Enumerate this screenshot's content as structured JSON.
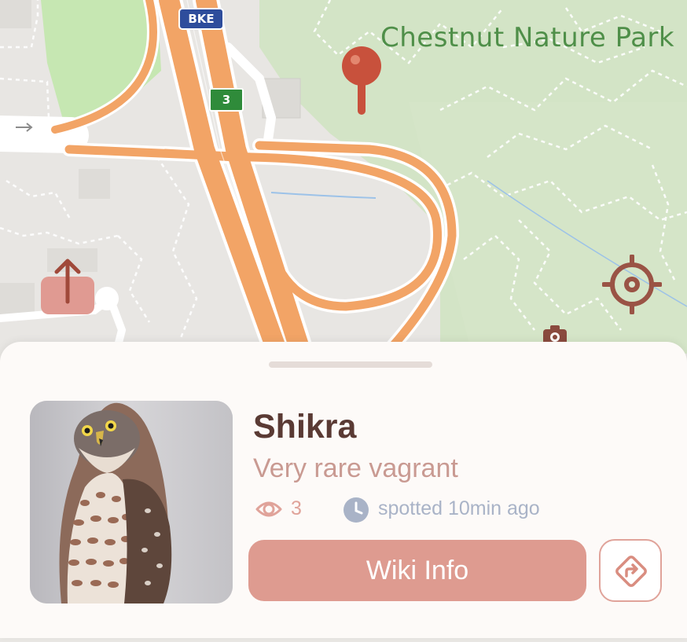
{
  "map": {
    "park_label": "Chestnut Nature Park",
    "road_shield_label": "BKE",
    "exit_shield_label": "3",
    "icons": {
      "marker": "map-pin-icon",
      "north": "north-arrow-icon",
      "locate": "locate-crosshair-icon",
      "camera": "camera-icon"
    }
  },
  "sheet": {
    "bird": {
      "name": "Shikra",
      "status": "Very rare vagrant",
      "views": "3",
      "spotted": "spotted 10min ago"
    },
    "wiki_button_label": "Wiki Info",
    "icons": {
      "views": "eye-icon",
      "time": "clock-icon",
      "directions": "directions-icon"
    }
  },
  "colors": {
    "accent": "#de9b90",
    "title": "#5a3a34",
    "park_green": "#d3e4c6",
    "highway_orange": "#f2a466",
    "muted_blue": "#a9b3c7"
  }
}
